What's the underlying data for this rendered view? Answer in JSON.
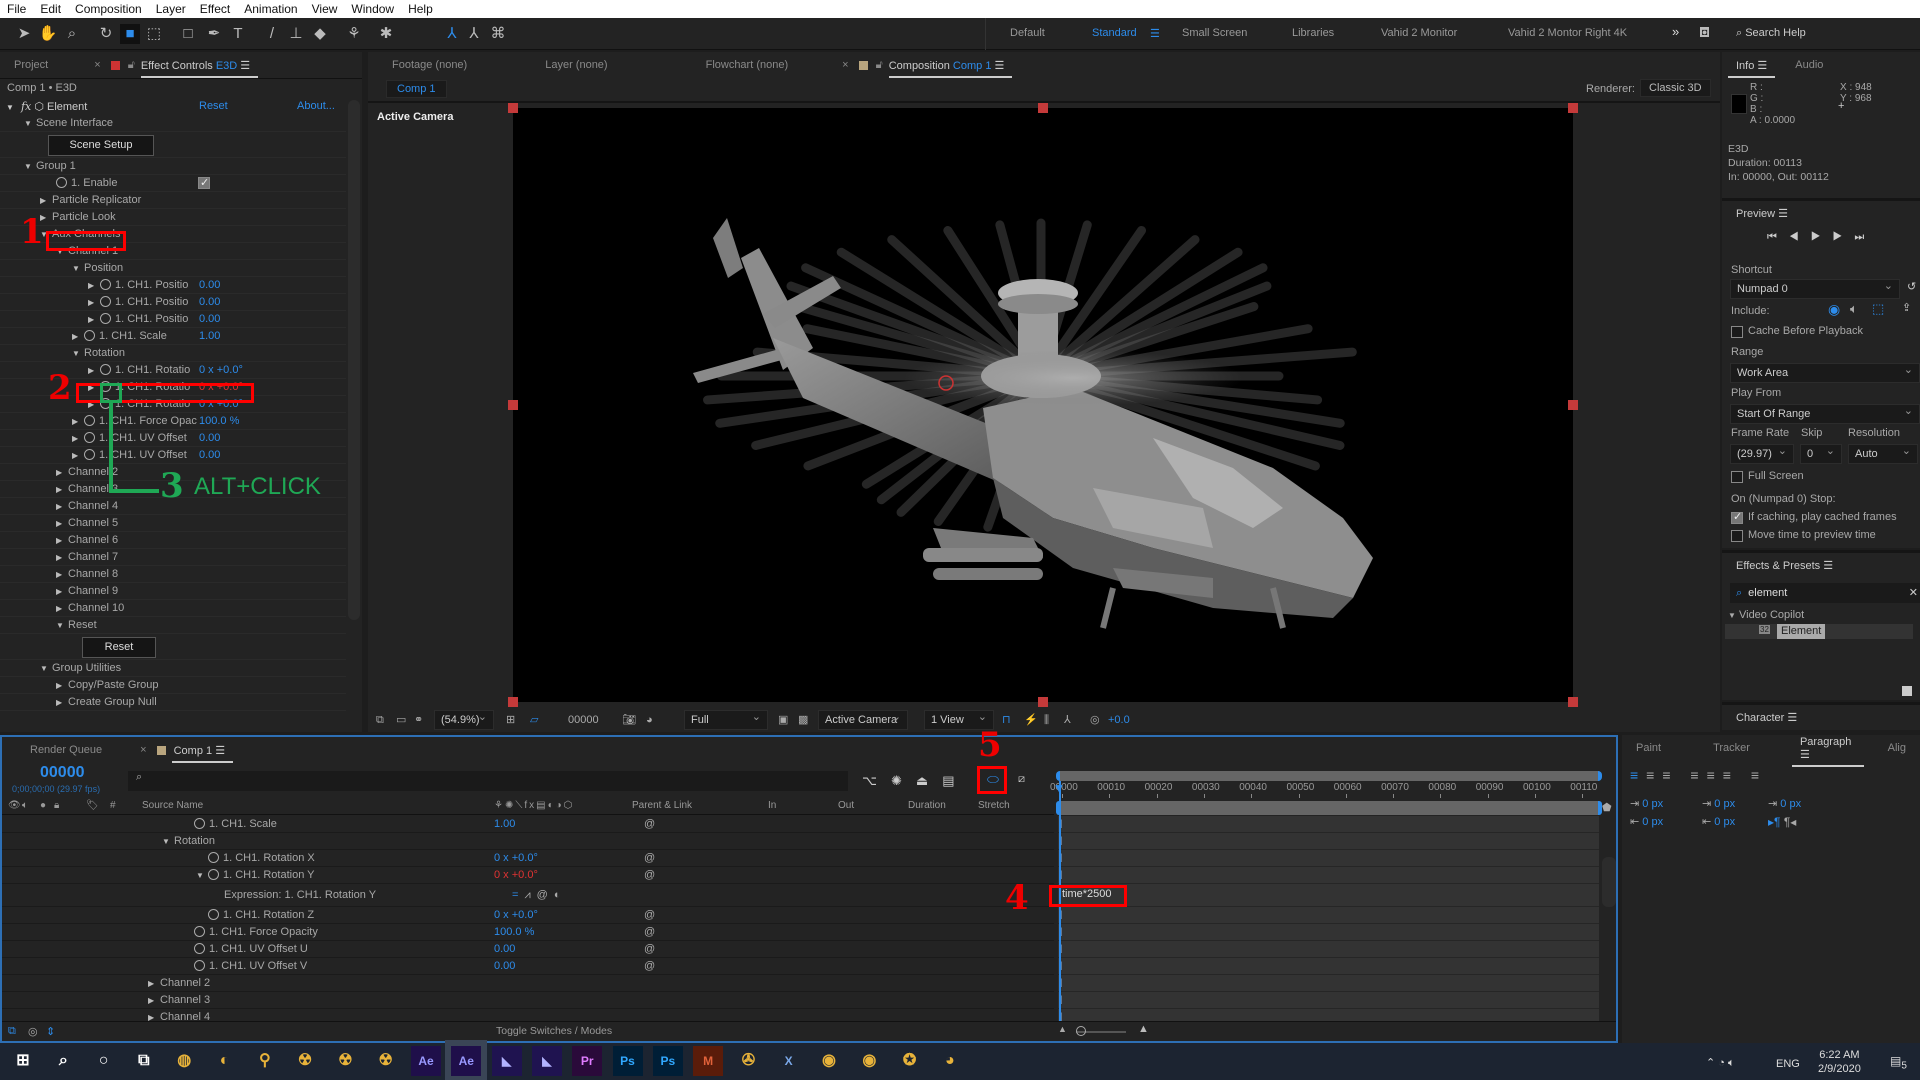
{
  "menu": [
    "File",
    "Edit",
    "Composition",
    "Layer",
    "Effect",
    "Animation",
    "View",
    "Window",
    "Help"
  ],
  "workspaces": {
    "items": [
      "Default",
      "Standard",
      "Small Screen",
      "Libraries",
      "Vahid 2 Monitor",
      "Vahid 2 Montor Right 4K"
    ],
    "active": "Standard",
    "more": "»",
    "search_placeholder": "Search Help"
  },
  "left_panel": {
    "tabs": {
      "project": "Project",
      "effect_controls": "Effect Controls",
      "layer": "E3D"
    },
    "breadcrumb": "Comp 1 • E3D",
    "effect": {
      "name": "Element",
      "reset": "Reset",
      "about": "About..."
    },
    "scene_setup_button": "Scene Setup",
    "reset_button": "Reset",
    "rows": [
      {
        "label": "Scene Interface",
        "depth": 1,
        "arrow": "down"
      },
      {
        "label": "",
        "depth": 0,
        "button": "scene_setup"
      },
      {
        "label": "Group 1",
        "depth": 1,
        "arrow": "down"
      },
      {
        "label": "1. Enable",
        "depth": 3,
        "stopwatch": true,
        "checkbox": true
      },
      {
        "label": "Particle Replicator",
        "depth": 2,
        "arrow": "right"
      },
      {
        "label": "Particle Look",
        "depth": 2,
        "arrow": "right"
      },
      {
        "label": "Aux Channels",
        "depth": 2,
        "arrow": "down"
      },
      {
        "label": "Channel 1",
        "depth": 3,
        "arrow": "down"
      },
      {
        "label": "Position",
        "depth": 4,
        "arrow": "down"
      },
      {
        "label": "1. CH1. Positio",
        "depth": 5,
        "arrow": "right",
        "stopwatch": true,
        "value": "0.00"
      },
      {
        "label": "1. CH1. Positio",
        "depth": 5,
        "arrow": "right",
        "stopwatch": true,
        "value": "0.00"
      },
      {
        "label": "1. CH1. Positio",
        "depth": 5,
        "arrow": "right",
        "stopwatch": true,
        "value": "0.00"
      },
      {
        "label": "1. CH1. Scale",
        "depth": 4,
        "arrow": "right",
        "stopwatch": true,
        "value": "1.00"
      },
      {
        "label": "Rotation",
        "depth": 4,
        "arrow": "down"
      },
      {
        "label": "1. CH1. Rotatio",
        "depth": 5,
        "arrow": "right",
        "stopwatch": true,
        "value": "0 x +0.0°"
      },
      {
        "label": "1. CH1. Rotatio",
        "depth": 5,
        "arrow": "right",
        "stopwatch": true,
        "value": "0 x +0.0°",
        "value_state": "expression"
      },
      {
        "label": "1. CH1. Rotatio",
        "depth": 5,
        "arrow": "right",
        "stopwatch": true,
        "value": "0 x +0.0°"
      },
      {
        "label": "1. CH1. Force Opac",
        "depth": 4,
        "arrow": "right",
        "stopwatch": true,
        "value": "100.0 %"
      },
      {
        "label": "1. CH1. UV Offset",
        "depth": 4,
        "arrow": "right",
        "stopwatch": true,
        "value": "0.00"
      },
      {
        "label": "1. CH1. UV Offset",
        "depth": 4,
        "arrow": "right",
        "stopwatch": true,
        "value": "0.00"
      },
      {
        "label": "Channel 2",
        "depth": 3,
        "arrow": "right"
      },
      {
        "label": "Channel 3",
        "depth": 3,
        "arrow": "right"
      },
      {
        "label": "Channel 4",
        "depth": 3,
        "arrow": "right"
      },
      {
        "label": "Channel 5",
        "depth": 3,
        "arrow": "right"
      },
      {
        "label": "Channel 6",
        "depth": 3,
        "arrow": "right"
      },
      {
        "label": "Channel 7",
        "depth": 3,
        "arrow": "right"
      },
      {
        "label": "Channel 8",
        "depth": 3,
        "arrow": "right"
      },
      {
        "label": "Channel 9",
        "depth": 3,
        "arrow": "right"
      },
      {
        "label": "Channel 10",
        "depth": 3,
        "arrow": "right"
      },
      {
        "label": "Reset",
        "depth": 3,
        "arrow": "down"
      },
      {
        "label": "",
        "depth": 0,
        "button": "reset"
      },
      {
        "label": "Group Utilities",
        "depth": 2,
        "arrow": "down"
      },
      {
        "label": "Copy/Paste Group",
        "depth": 3,
        "arrow": "right"
      },
      {
        "label": "Create Group Null",
        "depth": 3,
        "arrow": "right"
      }
    ]
  },
  "comp_panel": {
    "tabs": {
      "footage": "Footage (none)",
      "layer": "Layer (none)",
      "flowchart": "Flowchart (none)",
      "composition": "Composition",
      "comp_name": "Comp 1"
    },
    "comp_chip": "Comp 1",
    "renderer_label": "Renderer:",
    "renderer": "Classic 3D",
    "view_label": "Active Camera",
    "bottom": {
      "zoom": "(54.9%)",
      "timecode": "00000",
      "resolution": "Full",
      "camera": "Active Camera",
      "views": "1 View",
      "exposure": "+0.0"
    }
  },
  "info_panel": {
    "tabs": [
      "Info",
      "Audio"
    ],
    "r": "R :",
    "g": "G :",
    "b": "B :",
    "a": "A : 0.0000",
    "x": "X : 948",
    "y": "Y : 968",
    "layer": "E3D",
    "duration": "Duration: 00113",
    "inout": "In: 00000, Out: 00112"
  },
  "preview_panel": {
    "title": "Preview",
    "shortcut_label": "Shortcut",
    "shortcut": "Numpad 0",
    "include_label": "Include:",
    "cache_before": "Cache Before Playback",
    "cache_before_checked": false,
    "range_label": "Range",
    "range": "Work Area",
    "play_from_label": "Play From",
    "play_from": "Start Of Range",
    "frame_rate_label": "Frame Rate",
    "frame_rate": "(29.97)",
    "skip_label": "Skip",
    "skip": "0",
    "resolution_label": "Resolution",
    "resolution": "Auto",
    "full_screen": "Full Screen",
    "full_screen_checked": false,
    "stop_label": "On (Numpad 0) Stop:",
    "if_caching": "If caching, play cached frames",
    "if_caching_checked": true,
    "move_time": "Move time to preview time",
    "move_time_checked": false
  },
  "effects_presets": {
    "title": "Effects & Presets",
    "search": "element",
    "category": "Video Copilot",
    "item": "Element"
  },
  "character": {
    "title": "Character"
  },
  "paragraph_panel": {
    "tabs": [
      "Paint",
      "Tracker",
      "Paragraph",
      "Alig"
    ],
    "active": "Paragraph",
    "values": [
      "0 px",
      "0 px",
      "0 px",
      "0 px",
      "0 px"
    ]
  },
  "timeline": {
    "tabs": {
      "render_queue": "Render Queue",
      "comp": "Comp 1"
    },
    "timecode": "00000",
    "timecode_sub": "0;00;00;00 (29.97 fps)",
    "columns": {
      "source_name": "Source Name",
      "parent": "Parent & Link",
      "in": "In",
      "out": "Out",
      "duration": "Duration",
      "stretch": "Stretch"
    },
    "ruler": [
      "00000",
      "00010",
      "00020",
      "00030",
      "00040",
      "00050",
      "00060",
      "00070",
      "00080",
      "00090",
      "00100",
      "00110"
    ],
    "rows": [
      {
        "label": "1. CH1. Scale",
        "depth": 2,
        "stopwatch": true,
        "value": "1.00"
      },
      {
        "label": "Rotation",
        "depth": 1,
        "arrow": "down"
      },
      {
        "label": "1. CH1. Rotation X",
        "depth": 3,
        "stopwatch": true,
        "value": "0 x +0.0°"
      },
      {
        "label": "1. CH1. Rotation Y",
        "depth": 3,
        "stopwatch": true,
        "arrow": "down",
        "value": "0 x +0.0°",
        "value_state": "expression"
      },
      {
        "label": "Expression: 1. CH1. Rotation Y",
        "depth": 4,
        "expression": "time*2500"
      },
      {
        "label": "1. CH1. Rotation Z",
        "depth": 3,
        "stopwatch": true,
        "value": "0 x +0.0°"
      },
      {
        "label": "1. CH1. Force Opacity",
        "depth": 2,
        "stopwatch": true,
        "value": "100.0 %"
      },
      {
        "label": "1. CH1. UV Offset U",
        "depth": 2,
        "stopwatch": true,
        "value": "0.00"
      },
      {
        "label": "1. CH1. UV Offset V",
        "depth": 2,
        "stopwatch": true,
        "value": "0.00"
      },
      {
        "label": "Channel 2",
        "depth": 0,
        "arrow": "right"
      },
      {
        "label": "Channel 3",
        "depth": 0,
        "arrow": "right"
      },
      {
        "label": "Channel 4",
        "depth": 0,
        "arrow": "right"
      }
    ],
    "toggle": "Toggle Switches / Modes"
  },
  "annotations": {
    "one": "1",
    "two": "2",
    "three": "3",
    "three_text": "ALT+CLICK",
    "four": "4",
    "five": "5"
  },
  "taskbar": {
    "apps": [
      "windows",
      "search",
      "cortana",
      "task-view",
      "chrome",
      "firefox",
      "search-app",
      "app1",
      "app2",
      "app3",
      "Ae",
      "Ae",
      "an",
      "an",
      "Pr",
      "Ps",
      "Ps",
      "M",
      "app4",
      "X",
      "c4d",
      "c4d",
      "app5",
      "app6"
    ],
    "lang": "ENG",
    "time": "6:22 AM",
    "date": "2/9/2020",
    "notifications": "5"
  },
  "colors": {
    "accent": "#2d8ceb",
    "annotation_red": "#ff0000",
    "annotation_green": "#1fa855",
    "expression_red": "#e03333"
  }
}
